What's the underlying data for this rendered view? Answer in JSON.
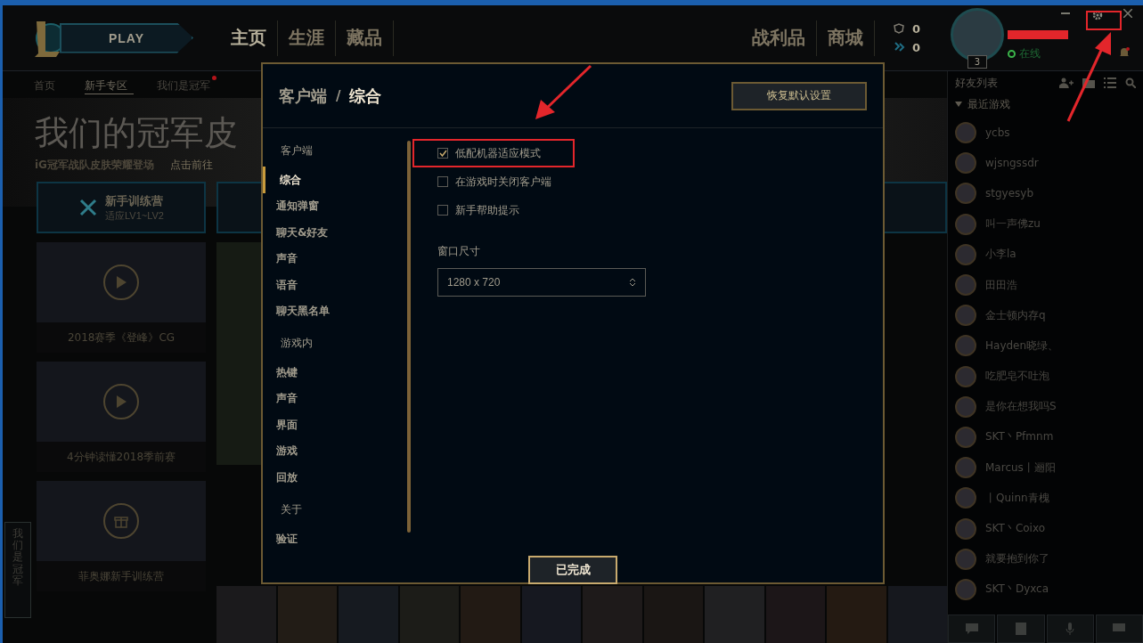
{
  "topbar": {
    "play": "PLAY",
    "tabs": [
      {
        "label": "主页",
        "selected": true
      },
      {
        "label": "生涯",
        "selected": false
      },
      {
        "label": "藏品",
        "selected": false
      }
    ],
    "right_tabs": [
      {
        "label": "战利品",
        "selected": false
      },
      {
        "label": "商城",
        "selected": false
      }
    ],
    "currencies": [
      {
        "kind": "rp",
        "amount": "0"
      },
      {
        "kind": "essence",
        "amount": "0"
      }
    ],
    "profile": {
      "level": "3",
      "status": "在线"
    }
  },
  "subnav": [
    {
      "label": "首页",
      "selected": false,
      "badge": false
    },
    {
      "label": "新手专区",
      "selected": true,
      "badge": false
    },
    {
      "label": "我们是冠军",
      "selected": false,
      "badge": true
    }
  ],
  "hero": {
    "title": "我们的冠军皮",
    "subtitle": "iG冠军战队皮肤荣耀登场",
    "link": "点击前往"
  },
  "training": {
    "title": "新手训练营",
    "subtitle": "适应LV1~LV2"
  },
  "videos": [
    {
      "caption": "2018赛季《登峰》CG",
      "kind": "play"
    },
    {
      "caption": "4分钟读懂2018季前赛",
      "kind": "play"
    },
    {
      "caption": "菲奥娜新手训练营",
      "kind": "gift"
    }
  ],
  "side_tab": "我们是冠军",
  "friends": {
    "title": "好友列表",
    "group": {
      "label": "最近游戏",
      "expanded": true
    },
    "items": [
      "ycbs",
      "wjsngssdr",
      "stgyesyb",
      "叫一声佛zu",
      "小李la",
      "田田浩",
      "金士顿内存q",
      "Hayden晓绿、",
      "吃肥皂不吐泡",
      "是你在想我吗S",
      "SKT丶Pfmnm",
      "Marcus丨逦阳",
      "丨Quinn青槐",
      "SKT丶Coixo",
      "就要抱到你了",
      "SKT丶Dyxca"
    ]
  },
  "settings": {
    "breadcrumb": "客户端",
    "separator": "/",
    "title": "综合",
    "reset_button": "恢复默认设置",
    "nav": [
      {
        "heading": "客户端",
        "items": [
          {
            "label": "综合",
            "selected": true
          },
          {
            "label": "通知弹窗",
            "selected": false
          },
          {
            "label": "聊天&好友",
            "selected": false
          },
          {
            "label": "声音",
            "selected": false
          },
          {
            "label": "语音",
            "selected": false
          },
          {
            "label": "聊天黑名单",
            "selected": false
          }
        ]
      },
      {
        "heading": "游戏内",
        "items": [
          {
            "label": "热键",
            "selected": false
          },
          {
            "label": "声音",
            "selected": false
          },
          {
            "label": "界面",
            "selected": false
          },
          {
            "label": "游戏",
            "selected": false
          },
          {
            "label": "回放",
            "selected": false
          }
        ]
      },
      {
        "heading": "关于",
        "items": [
          {
            "label": "验证",
            "selected": false
          }
        ]
      }
    ],
    "options": [
      {
        "label": "低配机器适应模式",
        "checked": true,
        "highlighted": true
      },
      {
        "label": "在游戏时关闭客户端",
        "checked": false,
        "highlighted": false
      },
      {
        "label": "新手帮助提示",
        "checked": false,
        "highlighted": false
      }
    ],
    "window_size": {
      "label": "窗口尺寸",
      "value": "1280 x 720"
    },
    "done_button": "已完成"
  }
}
